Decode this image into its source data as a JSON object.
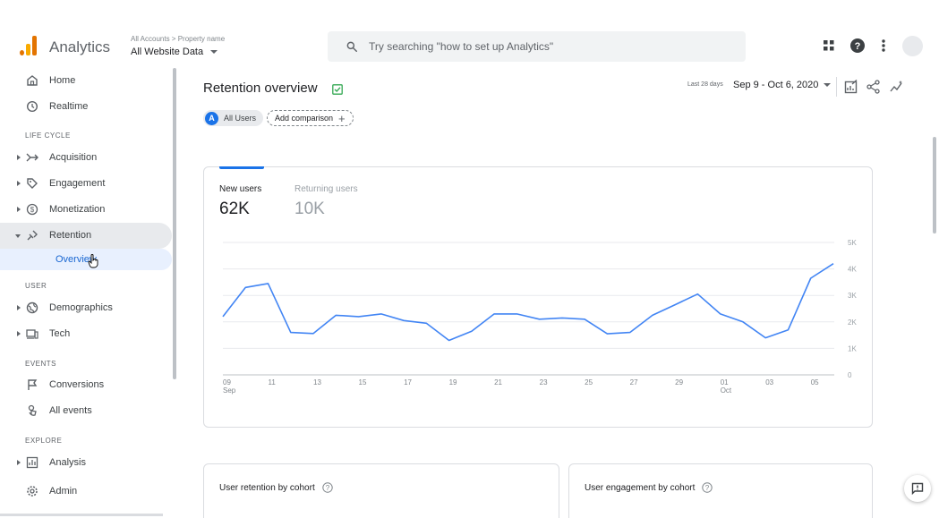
{
  "header": {
    "app_title": "Analytics",
    "account_breadcrumb": "All Accounts > Property name",
    "property_name": "All Website Data",
    "search_placeholder": "Try searching \"how to set up Analytics\"",
    "icons": [
      "apps-grid-icon",
      "help-icon",
      "more-vert-icon",
      "account-avatar"
    ]
  },
  "sidebar": {
    "home": "Home",
    "realtime": "Realtime",
    "section_lifecycle": "LIFE CYCLE",
    "acquisition": "Acquisition",
    "engagement": "Engagement",
    "monetization": "Monetization",
    "retention": "Retention",
    "overview": "Overview",
    "section_user": "USER",
    "demographics": "Demographics",
    "tech": "Tech",
    "section_events": "EVENTS",
    "conversions": "Conversions",
    "all_events": "All events",
    "section_explore": "EXPLORE",
    "analysis": "Analysis",
    "admin": "Admin"
  },
  "main": {
    "title": "Retention overview",
    "date_label": "Last 28 days",
    "date_range": "Sep 9 - Oct 6, 2020",
    "chip_avatar": "A",
    "chip_users": "All Users",
    "add_comparison": "Add comparison",
    "metrics": [
      {
        "label": "New users",
        "value": "62K"
      },
      {
        "label": "Returning users",
        "value": "10K"
      }
    ],
    "cards": [
      {
        "title": "User retention by cohort"
      },
      {
        "title": "User engagement by cohort"
      }
    ]
  },
  "colors": {
    "accent": "#1a73e8",
    "line": "#4285f4",
    "logo_orange": "#f9ab00",
    "logo_dark": "#e37400"
  },
  "chart_data": {
    "type": "line",
    "series": [
      {
        "name": "New users",
        "values": [
          2200,
          3300,
          3450,
          1600,
          1560,
          2250,
          2200,
          2300,
          2050,
          1950,
          1300,
          1650,
          2300,
          2300,
          2100,
          2150,
          2100,
          1550,
          1600,
          2250,
          2650,
          3050,
          2300,
          2000,
          1400,
          1700,
          3650,
          4200
        ]
      }
    ],
    "x_tick_labels": [
      {
        "index": 0,
        "label": "09",
        "sub": "Sep"
      },
      {
        "index": 2,
        "label": "11",
        "sub": ""
      },
      {
        "index": 4,
        "label": "13",
        "sub": ""
      },
      {
        "index": 6,
        "label": "15",
        "sub": ""
      },
      {
        "index": 8,
        "label": "17",
        "sub": ""
      },
      {
        "index": 10,
        "label": "19",
        "sub": ""
      },
      {
        "index": 12,
        "label": "21",
        "sub": ""
      },
      {
        "index": 14,
        "label": "23",
        "sub": ""
      },
      {
        "index": 16,
        "label": "25",
        "sub": ""
      },
      {
        "index": 18,
        "label": "27",
        "sub": ""
      },
      {
        "index": 20,
        "label": "29",
        "sub": ""
      },
      {
        "index": 22,
        "label": "01",
        "sub": "Oct"
      },
      {
        "index": 24,
        "label": "03",
        "sub": ""
      },
      {
        "index": 26,
        "label": "05",
        "sub": ""
      }
    ],
    "y_ticks": [
      {
        "value": 5000,
        "label": "5K"
      },
      {
        "value": 4000,
        "label": "4K"
      },
      {
        "value": 3000,
        "label": "3K"
      },
      {
        "value": 2000,
        "label": "2K"
      },
      {
        "value": 1000,
        "label": "1K"
      },
      {
        "value": 0,
        "label": "0"
      }
    ],
    "ylim": [
      0,
      5000
    ],
    "grid": true,
    "y_axis_side": "right"
  }
}
